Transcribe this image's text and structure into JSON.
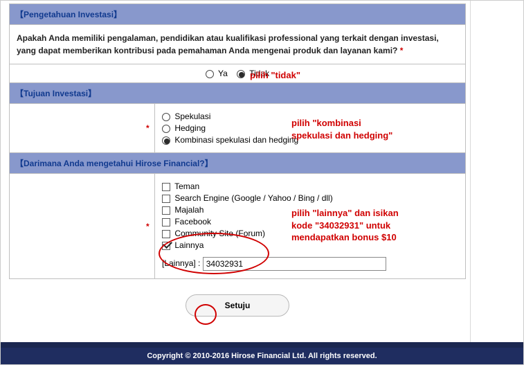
{
  "section1": {
    "header": "【Pengetahuan Investasi】",
    "question": "Apakah Anda memiliki pengalaman, pendidikan atau kualifikasi professional yang terkait dengan investasi, yang dapat memberikan kontribusi pada pemahaman Anda mengenai produk dan layanan kami?",
    "required_mark": "*",
    "option_yes": "Ya",
    "option_no": "Tidak",
    "selected": "Tidak"
  },
  "section2": {
    "header": "【Tujuan Investasi】",
    "required_mark": "*",
    "options": {
      "spekulasi": "Spekulasi",
      "hedging": "Hedging",
      "kombinasi": "Kombinasi spekulasi dan hedging"
    },
    "selected": "kombinasi"
  },
  "section3": {
    "header": "【Darimana Anda mengetahui Hirose Financial?】",
    "required_mark": "*",
    "options": {
      "teman": "Teman",
      "search": "Search Engine (Google / Yahoo / Bing / dll)",
      "majalah": "Majalah",
      "facebook": "Facebook",
      "community": "Community Site (Forum)",
      "lainnya": "Lainnya"
    },
    "checked": [
      "lainnya"
    ],
    "lainnya_label": "[Lainnya] :",
    "lainnya_value": "34032931"
  },
  "annotations": {
    "a1": "pilih \"tidak\"",
    "a2_line1": "pilih \"kombinasi",
    "a2_line2": "spekulasi dan hedging\"",
    "a3_line1": "pilih \"lainnya\" dan isikan",
    "a3_line2": "kode \"34032931\" untuk",
    "a3_line3": "mendapatkan bonus $10"
  },
  "submit_label": "Setuju",
  "footer_text": "Copyright © 2010-2016 Hirose Financial Ltd. All rights reserved."
}
